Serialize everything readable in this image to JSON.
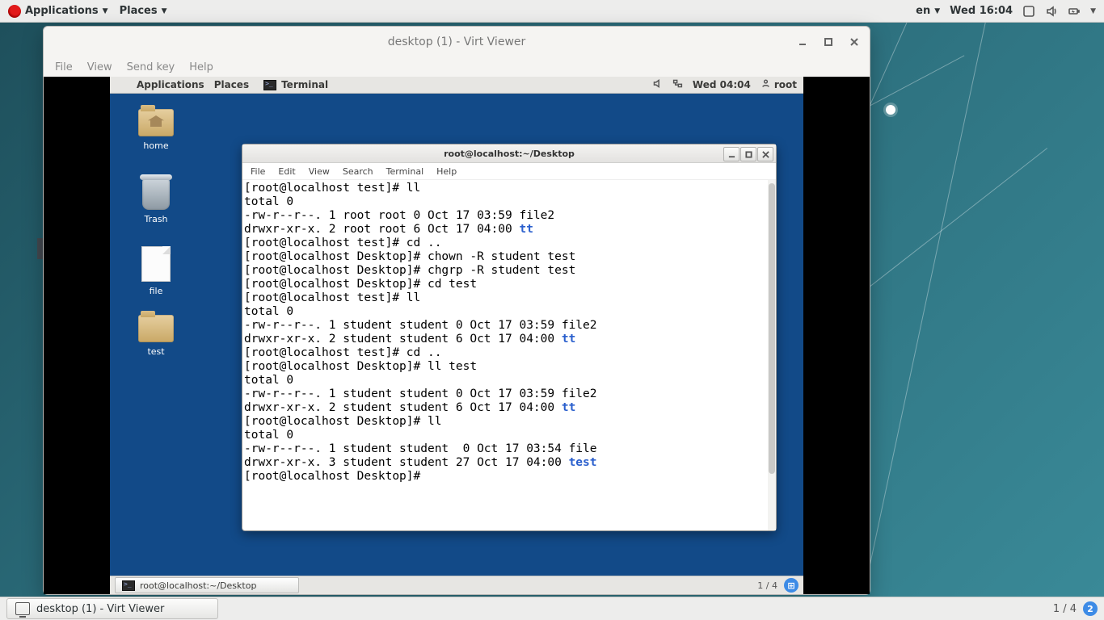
{
  "host": {
    "topbar": {
      "applications": "Applications",
      "places": "Places",
      "lang": "en",
      "clock": "Wed 16:04"
    },
    "taskbar": {
      "active_task": "desktop (1) - Virt Viewer",
      "workspace": "1 / 4",
      "workspace_badge": "2"
    }
  },
  "viewer": {
    "title": "desktop (1) - Virt Viewer",
    "menu": {
      "file": "File",
      "view": "View",
      "sendkey": "Send key",
      "help": "Help"
    }
  },
  "guest": {
    "topbar": {
      "applications": "Applications",
      "places": "Places",
      "active_app": "Terminal",
      "clock": "Wed 04:04",
      "user": "root"
    },
    "icons": {
      "home": "home",
      "trash": "Trash",
      "file": "file",
      "test": "test"
    },
    "bottombar": {
      "active_task": "root@localhost:~/Desktop",
      "workspace": "1 / 4"
    }
  },
  "terminal": {
    "title": "root@localhost:~/Desktop",
    "menu": {
      "file": "File",
      "edit": "Edit",
      "view": "View",
      "search": "Search",
      "terminal": "Terminal",
      "help": "Help"
    },
    "lines": [
      {
        "prompt": "[root@localhost test]# ",
        "cmd": "ll"
      },
      {
        "text": "total 0"
      },
      {
        "text": "-rw-r--r--. 1 root root 0 Oct 17 03:59 file2"
      },
      {
        "text": "drwxr-xr-x. 2 root root 6 Oct 17 04:00 ",
        "link": "tt"
      },
      {
        "prompt": "[root@localhost test]# ",
        "cmd": "cd .."
      },
      {
        "prompt": "[root@localhost Desktop]# ",
        "cmd": "chown -R student test"
      },
      {
        "prompt": "[root@localhost Desktop]# ",
        "cmd": "chgrp -R student test"
      },
      {
        "prompt": "[root@localhost Desktop]# ",
        "cmd": "cd test"
      },
      {
        "prompt": "[root@localhost test]# ",
        "cmd": "ll"
      },
      {
        "text": "total 0"
      },
      {
        "text": "-rw-r--r--. 1 student student 0 Oct 17 03:59 file2"
      },
      {
        "text": "drwxr-xr-x. 2 student student 6 Oct 17 04:00 ",
        "link": "tt"
      },
      {
        "prompt": "[root@localhost test]# ",
        "cmd": "cd .."
      },
      {
        "prompt": "[root@localhost Desktop]# ",
        "cmd": "ll test"
      },
      {
        "text": "total 0"
      },
      {
        "text": "-rw-r--r--. 1 student student 0 Oct 17 03:59 file2"
      },
      {
        "text": "drwxr-xr-x. 2 student student 6 Oct 17 04:00 ",
        "link": "tt"
      },
      {
        "prompt": "[root@localhost Desktop]# ",
        "cmd": "ll"
      },
      {
        "text": "total 0"
      },
      {
        "text": "-rw-r--r--. 1 student student  0 Oct 17 03:54 file"
      },
      {
        "text": "drwxr-xr-x. 3 student student 27 Oct 17 04:00 ",
        "link": "test"
      },
      {
        "prompt": "[root@localhost Desktop]# ",
        "cmd": ""
      }
    ]
  }
}
